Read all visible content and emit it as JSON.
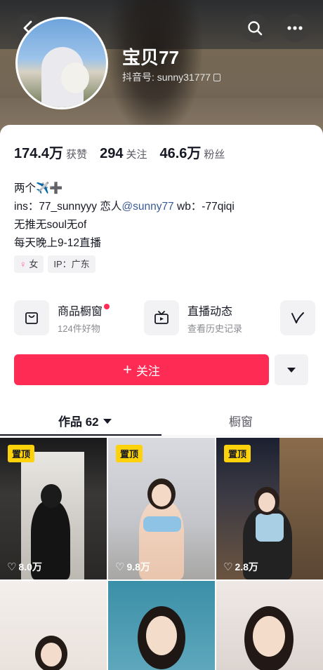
{
  "header": {
    "nickname": "宝贝77",
    "douyin_id": "抖音号: sunny31777"
  },
  "icons": {
    "back": "chevron-left-icon",
    "search": "search-icon",
    "more": "more-icon",
    "copy": "copy-icon",
    "shop": "shopping-bag-icon",
    "live": "tv-icon",
    "extra": "v-logo-icon",
    "heart": "heart-icon"
  },
  "stats": [
    {
      "value": "174.4万",
      "label": "获赞"
    },
    {
      "value": "294",
      "label": "关注"
    },
    {
      "value": "46.6万",
      "label": "粉丝"
    }
  ],
  "bio": {
    "line1": "两个✈️➕",
    "line2_prefix": "ins：77_sunnyyy  恋人",
    "line2_mention": "@sunny77",
    "line2_suffix": " wb：-77qiqi",
    "line3": "无推无soul无of",
    "line4": "每天晚上9-12直播"
  },
  "tags": {
    "gender_symbol": "♀",
    "gender": "女",
    "ip": "IP：广东"
  },
  "shortcuts": {
    "shop_title": "商品橱窗",
    "shop_sub": "124件好物",
    "live_title": "直播动态",
    "live_sub": "查看历史记录"
  },
  "actions": {
    "follow_plus": "+",
    "follow": "关注"
  },
  "tabs": {
    "works": "作品 62",
    "shop": "橱窗"
  },
  "videos": [
    {
      "pinned": "置顶",
      "likes": "8.0万"
    },
    {
      "pinned": "置顶",
      "likes": "9.8万"
    },
    {
      "pinned": "置顶",
      "likes": "2.8万"
    },
    {
      "pinned": "",
      "likes": ""
    },
    {
      "pinned": "",
      "likes": ""
    },
    {
      "pinned": "",
      "likes": ""
    }
  ],
  "colors": {
    "accent": "#fe2c55",
    "pin": "#fdd20b",
    "mention": "#3a5a96"
  }
}
